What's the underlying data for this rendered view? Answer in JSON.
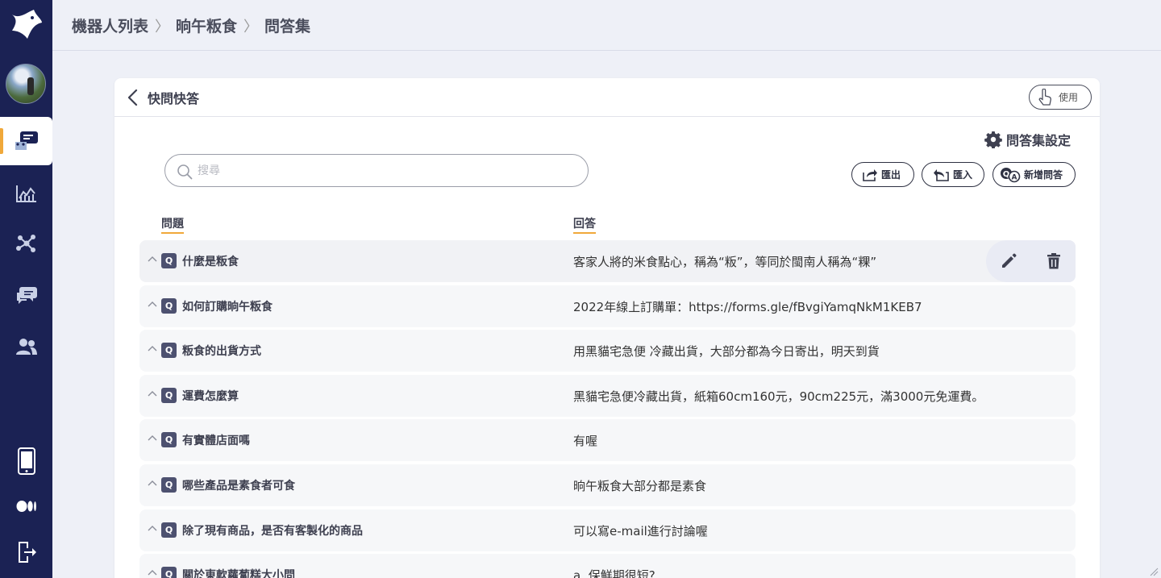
{
  "breadcrumb": [
    "機器人列表",
    "晌午粄食",
    "問答集"
  ],
  "card": {
    "title": "快問快答",
    "use_label": "使用",
    "settings_label": "問答集設定"
  },
  "search": {
    "placeholder": "搜尋"
  },
  "buttons": {
    "export": "匯出",
    "import": "匯入",
    "add": "新增問答"
  },
  "columns": {
    "question": "問題",
    "answer": "回答"
  },
  "qa_badge": "Q",
  "rows": [
    {
      "q": "什麼是粄食",
      "a": "客家人將的米食點心，稱為“粄”，等同於閩南人稱為“粿”"
    },
    {
      "q": "如何訂購晌午粄食",
      "a": "2022年線上訂購單：https://forms.gle/fBvgiYamqNkM1KEB7"
    },
    {
      "q": "粄食的出貨方式",
      "a": "用黑貓宅急便 冷藏出貨，大部分都為今日寄出，明天到貨"
    },
    {
      "q": "運費怎麼算",
      "a": "黑貓宅急便冷藏出貨，紙箱60cm160元，90cm225元，滿3000元免運費。"
    },
    {
      "q": "有實體店面嗎",
      "a": "有喔"
    },
    {
      "q": "哪些產品是素食者可食",
      "a": "晌午粄食大部分都是素食"
    },
    {
      "q": "除了現有商品，是否有客製化的商品",
      "a": "可以寫e-mail進行討論喔"
    },
    {
      "q": "關於東軟蘿蔔糕大小問",
      "a": "a. 保鮮期很短?"
    }
  ],
  "colors": {
    "sidebar": "#1b2254",
    "accent": "#f0a83a",
    "badge": "#4d5170"
  },
  "icons": [
    "logo-icon",
    "chat-bot-icon",
    "analytics-icon",
    "network-icon",
    "messages-icon",
    "users-icon",
    "phone-icon",
    "medium-icon",
    "logout-icon",
    "settings-gear-icon",
    "search-icon",
    "hand-pointer-icon",
    "export-icon",
    "import-icon",
    "add-qa-icon",
    "edit-pencil-icon",
    "trash-icon",
    "chevron-up-icon",
    "chevron-left-icon"
  ]
}
